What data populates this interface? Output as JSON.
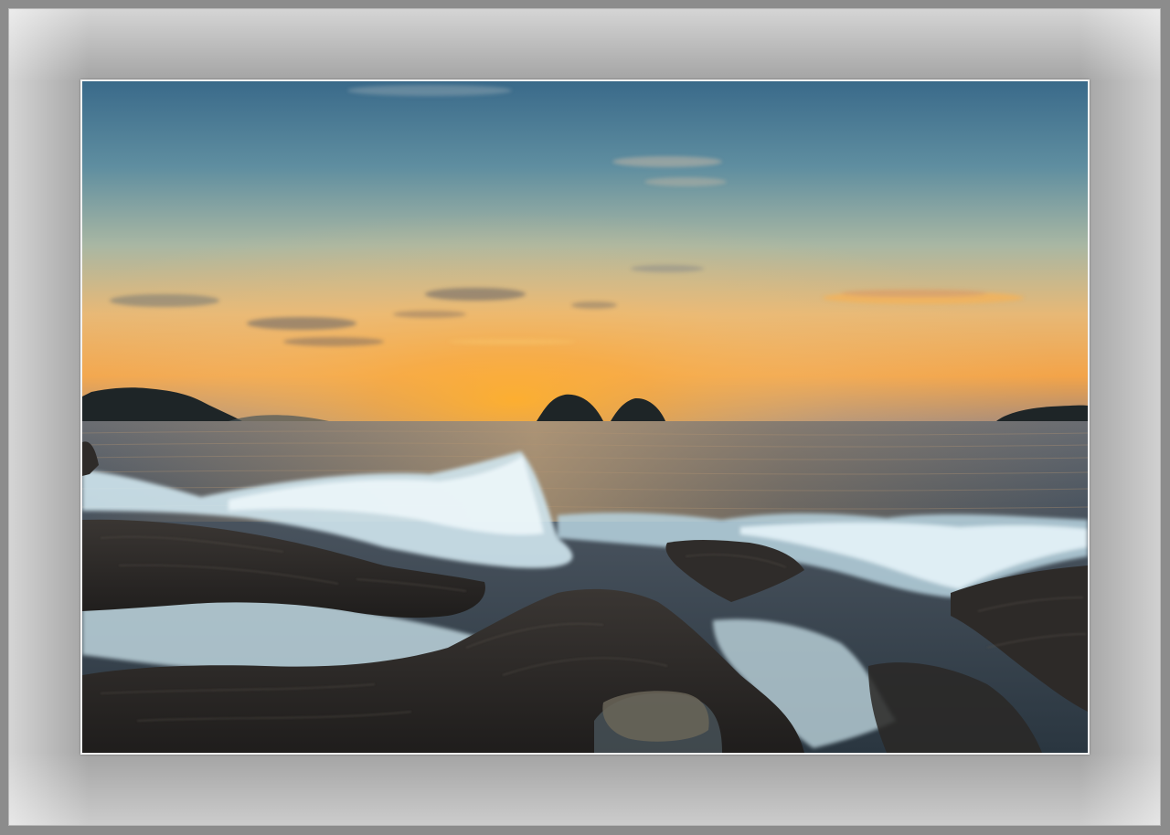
{
  "image": {
    "description_colors": {
      "sky_top": "#3d6f8e",
      "sky_mid": "#8fa8a8",
      "sky_glow": "#f2b24a",
      "sun": "#ffb23a",
      "sea": "#3d4a52",
      "foam": "#d8eef4",
      "rock": "#2c2b2a",
      "mat": "#a3a3a3",
      "frame": "#8c8c8c"
    }
  }
}
